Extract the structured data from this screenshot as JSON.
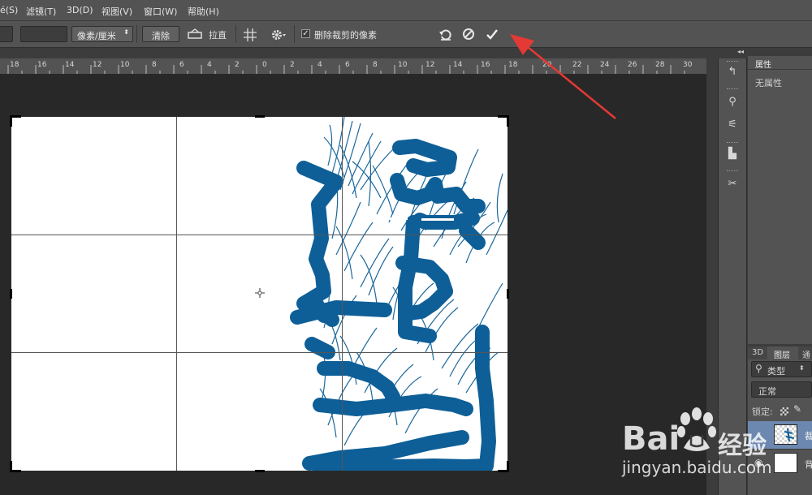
{
  "menubar": {
    "items": [
      "滤镜(T)",
      "3D(D)",
      "视图(V)",
      "窗口(W)",
      "帮助(H)"
    ],
    "partial_left": "é(S)"
  },
  "options": {
    "units_select": "像素/厘米",
    "clear_button": "清除",
    "straighten_label": "拉直",
    "delete_cropped_label": "删除裁剪的像素",
    "delete_cropped_checked": true
  },
  "ruler": {
    "ticks": [
      "18",
      "16",
      "14",
      "12",
      "10",
      "8",
      "6",
      "4",
      "2",
      "0",
      "2",
      "4",
      "6",
      "8",
      "10",
      "12",
      "14",
      "16",
      "18",
      "20",
      "22",
      "24",
      "26",
      "28",
      "30"
    ]
  },
  "properties": {
    "tab": "属性",
    "empty_text": "无属性"
  },
  "layers": {
    "tabs": [
      "3D",
      "图层",
      "通"
    ],
    "kind_filter": "类型",
    "blend_mode": "正常",
    "lock_label": "锁定:",
    "rows": [
      {
        "name": "裁"
      },
      {
        "name": "背"
      }
    ]
  },
  "watermark": {
    "brand": "Bai",
    "brand_suffix": "经验",
    "url": "jingyan.baidu.com"
  },
  "colors": {
    "accent_arrow": "#e53935",
    "stroke_blue": "#0e5f97"
  }
}
